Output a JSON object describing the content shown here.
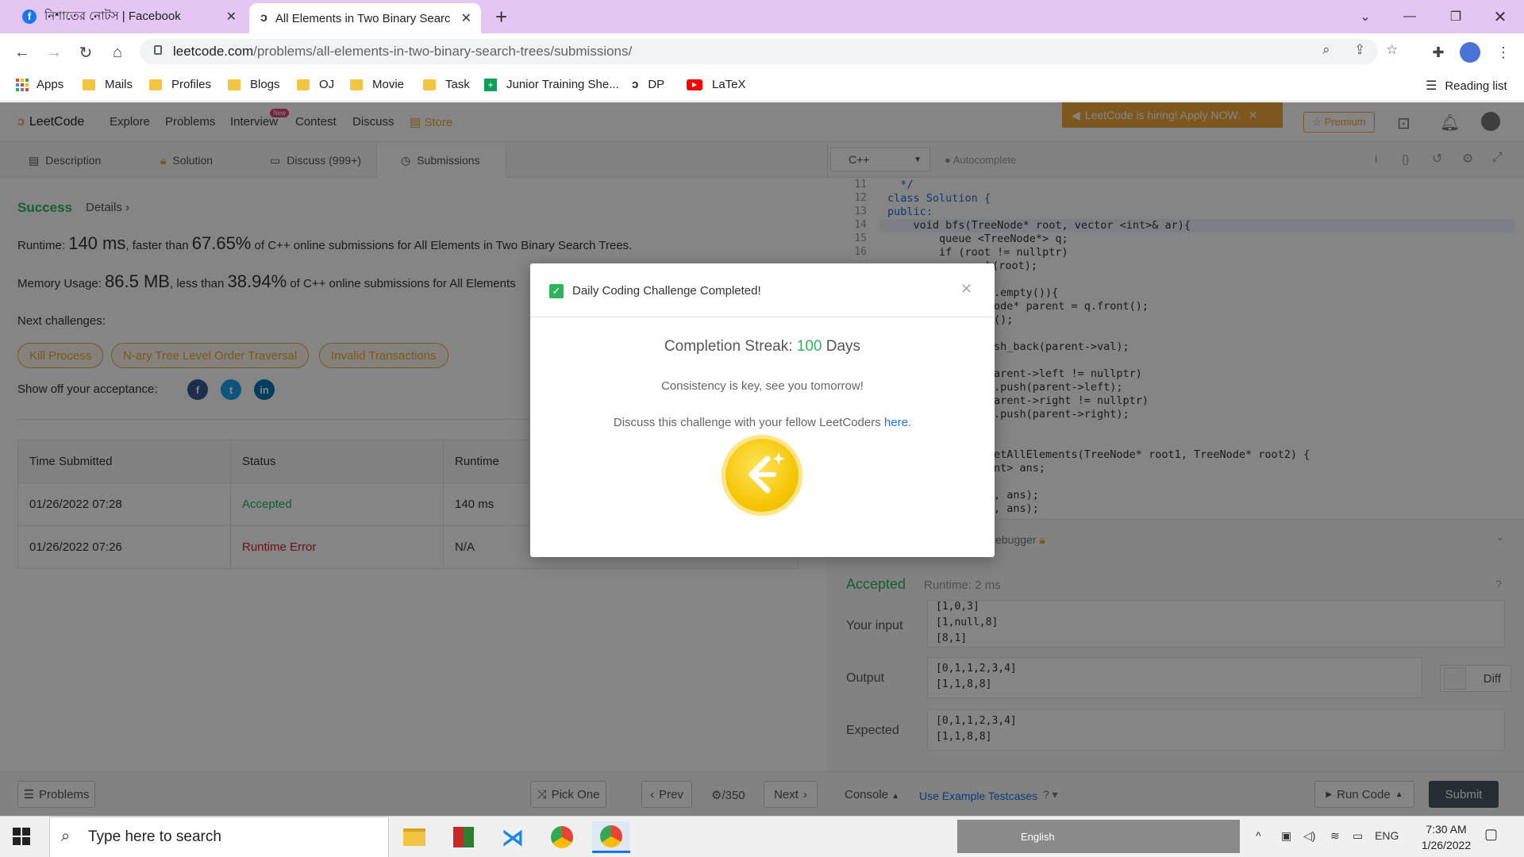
{
  "browser": {
    "tabs": [
      {
        "title": "নিশাতের নোটস | Facebook",
        "icon": "facebook-icon"
      },
      {
        "title": "All Elements in Two Binary Search",
        "icon": "leetcode-icon",
        "active": true
      }
    ],
    "url_host": "leetcode.com",
    "url_path": "/problems/all-elements-in-two-binary-search-trees/submissions/",
    "bookmarks": [
      "Apps",
      "Mails",
      "Profiles",
      "Blogs",
      "OJ",
      "Movie",
      "Task",
      "Junior Training She...",
      "DP",
      "LaTeX"
    ],
    "reading_list": "Reading list"
  },
  "nav": {
    "logo": "LeetCode",
    "items": [
      "Explore",
      "Problems",
      "Interview",
      "Contest",
      "Discuss",
      "Store"
    ],
    "new_badge": "New",
    "hiring": "LeetCode is hiring! Apply NOW.",
    "premium": "☆ Premium"
  },
  "tabs": [
    "Description",
    "Solution",
    "Discuss (999+)",
    "Submissions"
  ],
  "submission": {
    "status": "Success",
    "details": "Details",
    "runtime_label": "Runtime:",
    "runtime_value": "140 ms",
    "runtime_faster": ", faster than",
    "runtime_pct": "67.65%",
    "runtime_tail": "of C++ online submissions for All Elements in Two Binary Search Trees.",
    "memory_label": "Memory Usage:",
    "memory_value": "86.5 MB",
    "memory_less": ", less than",
    "memory_pct": "38.94%",
    "memory_tail": "of C++ online submissions for All Elements",
    "next_label": "Next challenges:",
    "next": [
      "Kill Process",
      "N-ary Tree Level Order Traversal",
      "Invalid Transactions"
    ],
    "show_off": "Show off your acceptance:"
  },
  "table": {
    "headers": [
      "Time Submitted",
      "Status",
      "Runtime"
    ],
    "rows": [
      {
        "time": "01/26/2022 07:28",
        "status": "Accepted",
        "runtime": "140 ms",
        "color": "#2db55d"
      },
      {
        "time": "01/26/2022 07:26",
        "status": "Runtime Error",
        "runtime": "N/A",
        "color": "#c62828"
      }
    ]
  },
  "editor": {
    "language": "C++",
    "autocomplete": "Autocomplete",
    "line_numbers": [
      "11",
      "12",
      "13",
      "14",
      "15",
      "16"
    ],
    "lines": [
      "  */",
      "class Solution {",
      "public:",
      "    void bfs(TreeNode* root, vector <int>& ar){",
      "        queue <TreeNode*> q;",
      "        if (root != nullptr)",
      "h(root);",
      ".empty()){",
      "ode* parent = q.front();",
      "();",
      "sh_back(parent->val);",
      "arent->left != nullptr)",
      ".push(parent->left);",
      "arent->right != nullptr)",
      ".push(parent->right);",
      "etAllElements(TreeNode* root1, TreeNode* root2) {",
      "nt> ans;",
      ", ans);",
      ", ans);"
    ],
    "debugger": "Debugger"
  },
  "result": {
    "status": "Accepted",
    "runtime": "Runtime: 2 ms",
    "input_label": "Your input",
    "input": [
      "[1,0,3]",
      "[1,null,8]",
      "[8,1]"
    ],
    "output_label": "Output",
    "output": [
      "[0,1,1,2,3,4]",
      "[1,1,8,8]"
    ],
    "expected_label": "Expected",
    "expected": [
      "[0,1,1,2,3,4]",
      "[1,1,8,8]"
    ],
    "diff": "Diff"
  },
  "bottom": {
    "problems": "Problems",
    "pick_one": "Pick One",
    "prev": "Prev",
    "count": "/350",
    "next": "Next",
    "console": "Console",
    "example": "Use Example Testcases",
    "run": "Run Code",
    "submit": "Submit"
  },
  "modal": {
    "title": "Daily Coding Challenge Completed!",
    "streak_label": "Completion Streak:",
    "streak_num": "100",
    "streak_unit": "Days",
    "consistency": "Consistency is key, see you tomorrow!",
    "discuss": "Discuss this challenge with your fellow LeetCoders",
    "here": "here."
  },
  "taskbar": {
    "search": "Type here to search",
    "lang_bar": "English",
    "ime": "ENG",
    "time": "7:30 AM",
    "date": "1/26/2022"
  },
  "colors": {
    "accent": "#f0a73a",
    "success": "#2db55d",
    "link": "#1a73e8"
  }
}
